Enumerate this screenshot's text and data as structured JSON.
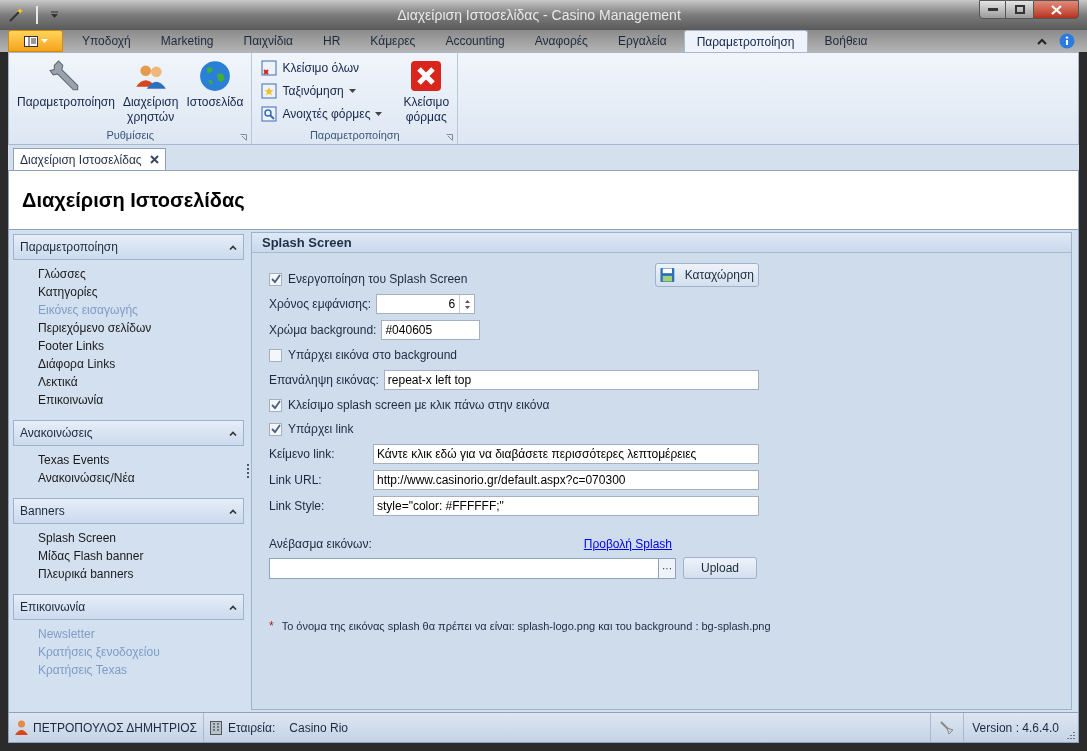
{
  "window": {
    "title": "Διαχείριση Ιστοσελίδας - Casino Management"
  },
  "ribbon_tabs": [
    {
      "label": "Υποδοχή",
      "selected": false
    },
    {
      "label": "Marketing",
      "selected": false
    },
    {
      "label": "Παιχνίδια",
      "selected": false
    },
    {
      "label": "HR",
      "selected": false
    },
    {
      "label": "Κάμερες",
      "selected": false
    },
    {
      "label": "Accounting",
      "selected": false
    },
    {
      "label": "Αναφορές",
      "selected": false
    },
    {
      "label": "Εργαλεία",
      "selected": false
    },
    {
      "label": "Παραμετροποίηση",
      "selected": true
    },
    {
      "label": "Βοήθεια",
      "selected": false
    }
  ],
  "ribbon_groups": [
    {
      "title": "Ρυθμίσεις",
      "buttons": [
        {
          "kind": "large",
          "lines": [
            "Παραμετροποίηση"
          ]
        },
        {
          "kind": "large",
          "lines": [
            "Διαχείριση",
            "χρηστών"
          ]
        },
        {
          "kind": "large",
          "lines": [
            "Ιστοσελίδα"
          ]
        }
      ]
    },
    {
      "title": "Παραμετροποίηση",
      "buttons": [
        {
          "kind": "small",
          "lines": [
            "Κλείσιμο όλων"
          ],
          "dropdown": false
        },
        {
          "kind": "small",
          "lines": [
            "Ταξινόμηση"
          ],
          "dropdown": true
        },
        {
          "kind": "small",
          "lines": [
            "Ανοιχτές φόρμες"
          ],
          "dropdown": true
        },
        {
          "kind": "large",
          "lines": [
            "Κλείσιμο",
            "φόρμας"
          ]
        }
      ]
    }
  ],
  "document_tab": {
    "label": "Διαχείριση Ιστοσελίδας"
  },
  "page_title": "Διαχείριση Ιστοσελίδας",
  "sidebar": [
    {
      "title": "Παραμετροποίηση",
      "expanded": true,
      "items": [
        {
          "label": "Γλώσσες",
          "disabled": false
        },
        {
          "label": "Κατηγορίες",
          "disabled": false
        },
        {
          "label": "Εικόνες εισαγωγής",
          "disabled": true
        },
        {
          "label": "Περιεχόμενο σελίδων",
          "disabled": false
        },
        {
          "label": "Footer Links",
          "disabled": false
        },
        {
          "label": "Διάφορα Links",
          "disabled": false
        },
        {
          "label": "Λεκτικά",
          "disabled": false
        },
        {
          "label": "Επικοινωνία",
          "disabled": false
        }
      ]
    },
    {
      "title": "Ανακοινώσεις",
      "expanded": true,
      "items": [
        {
          "label": "Texas Events",
          "disabled": false
        },
        {
          "label": "Ανακοινώσεις/Νέα",
          "disabled": false
        }
      ]
    },
    {
      "title": "Banners",
      "expanded": true,
      "items": [
        {
          "label": "Splash Screen",
          "disabled": false
        },
        {
          "label": "Μίδας Flash banner",
          "disabled": false
        },
        {
          "label": "Πλευρικά banners",
          "disabled": false
        }
      ]
    },
    {
      "title": "Επικοινωνία",
      "expanded": true,
      "items": [
        {
          "label": "Newsletter",
          "disabled": true
        },
        {
          "label": "Κρατήσεις ξενοδοχείου",
          "disabled": true
        },
        {
          "label": "Κρατήσεις Texas",
          "disabled": true
        }
      ]
    }
  ],
  "panel": {
    "title": "Splash Screen",
    "save_button": "Καταχώρηση",
    "rows": [
      {
        "kind": "checkbox",
        "label": "Ενεργοποίηση του Splash Screen",
        "checked": true
      },
      {
        "kind": "spin",
        "label": "Χρόνος εμφάνισης:",
        "value": "6"
      },
      {
        "kind": "short",
        "label": "Χρώμα background:",
        "value": "#040605"
      },
      {
        "kind": "checkbox",
        "label": "Υπάρχει εικόνα στο background",
        "checked": false
      },
      {
        "kind": "text",
        "label": "Επανάληψη εικόνας:",
        "value": "repeat-x left top"
      },
      {
        "kind": "checkbox",
        "label": "Κλείσιμο splash screen με κλικ πάνω στην εικόνα",
        "checked": true
      },
      {
        "kind": "checkbox",
        "label": "Υπάρχει link",
        "checked": true
      },
      {
        "kind": "text",
        "label": "Κείμενο link:",
        "value": "Κάντε κλικ εδώ για να διαβάσετε περισσότερες λεπτομέρειες"
      },
      {
        "kind": "text",
        "label": "Link URL:",
        "value": "http://www.casinorio.gr/default.aspx?c=070300"
      },
      {
        "kind": "text",
        "label": "Link Style:",
        "value": "style=\"color: #FFFFFF;\""
      }
    ],
    "upload_label": "Ανέβασμα εικόνων:",
    "preview_link": "Προβολή Splash",
    "browse_button": "···",
    "upload_button": "Upload",
    "note_mark": "*",
    "note": "Το όνομα της εικόνας splash θα πρέπει να είναι: splash-logo.png και του background : bg-splash.png"
  },
  "status_bar": {
    "user": "ΠΕΤΡΟΠΟΥΛΟΣ ΔΗΜΗΤΡΙΟΣ",
    "company_label": "Εταιρεία:",
    "company": "Casino Rio",
    "version": "Version : 4.6.4.0"
  }
}
